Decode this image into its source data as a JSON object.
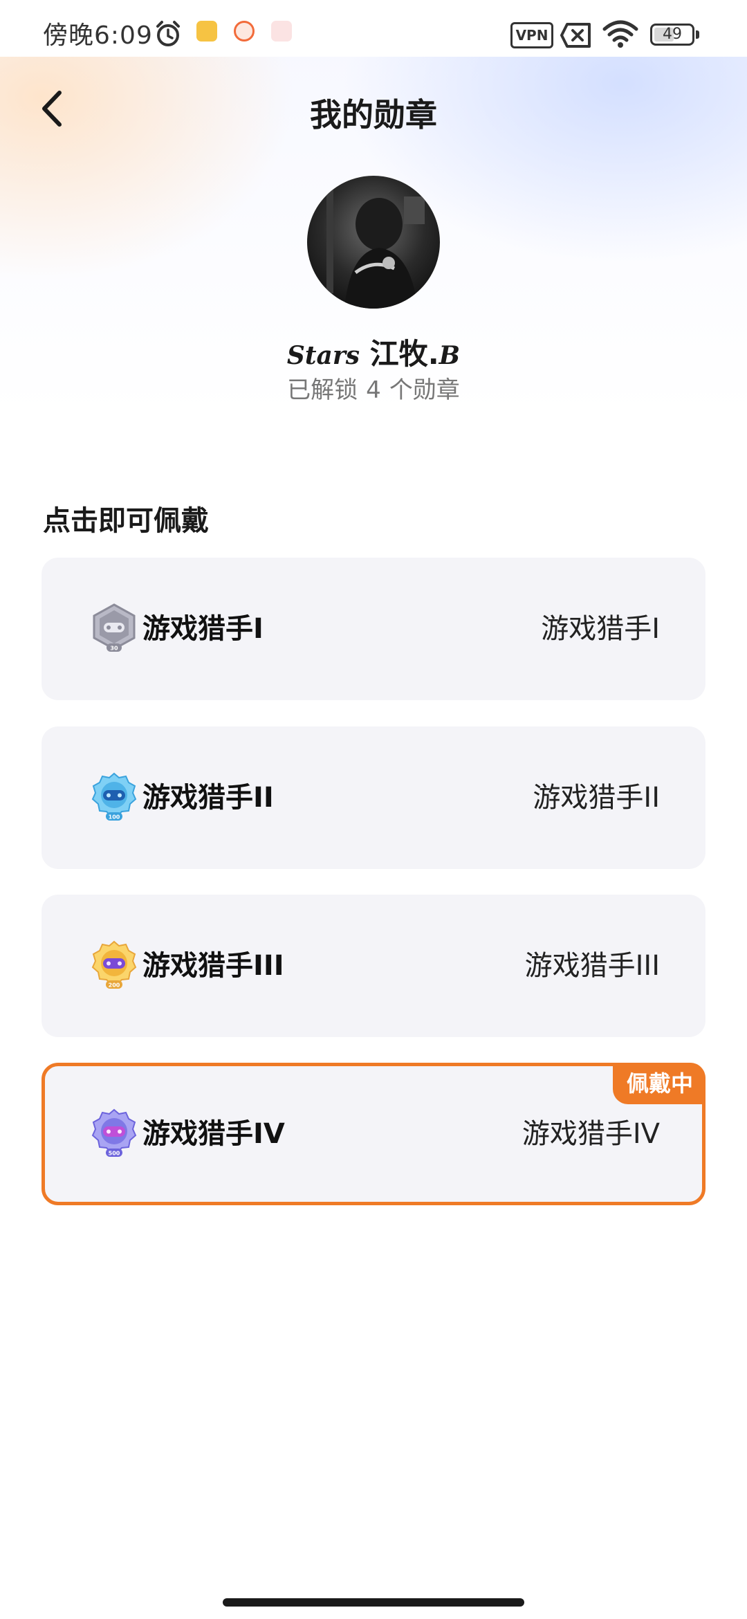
{
  "status_bar": {
    "time": "傍晚6:09",
    "vpn_label": "VPN",
    "battery_level": "49",
    "icons": [
      "alarm-icon",
      "notification-icon",
      "notification-icon",
      "notification-icon",
      "no-sim-icon",
      "wifi-icon",
      "battery-icon"
    ],
    "notification_colors": [
      "#f6c343",
      "#f26b3a",
      "#f3a3a3"
    ]
  },
  "header": {
    "back_icon": "chevron-left-icon",
    "title": "我的勋章"
  },
  "profile": {
    "name_script": "Stars",
    "name_main": " 江牧.",
    "name_suffix": "B",
    "unlock_prefix": "已解锁",
    "unlock_count": "4",
    "unlock_suffix": "个勋章"
  },
  "section": {
    "heading": "点击即可佩戴"
  },
  "badges": [
    {
      "name": "游戏猎手I",
      "value": "游戏猎手I",
      "icon": "gamepad-badge-icon",
      "icon_color": "#9a9aa8",
      "level_label": "30",
      "wearing": false
    },
    {
      "name": "游戏猎手II",
      "value": "游戏猎手II",
      "icon": "gamepad-badge-icon",
      "icon_color": "#4fb3e8",
      "level_label": "100",
      "wearing": false
    },
    {
      "name": "游戏猎手III",
      "value": "游戏猎手III",
      "icon": "gamepad-badge-icon",
      "icon_color": "#f2b53c",
      "level_label": "200",
      "wearing": false
    },
    {
      "name": "游戏猎手IV",
      "value": "游戏猎手IV",
      "icon": "gamepad-badge-icon",
      "icon_color": "#7f78e6",
      "level_label": "500",
      "wearing": true,
      "wearing_label": "佩戴中"
    }
  ],
  "colors": {
    "accent": "#ef7a26",
    "card_background": "#f4f4f8"
  }
}
